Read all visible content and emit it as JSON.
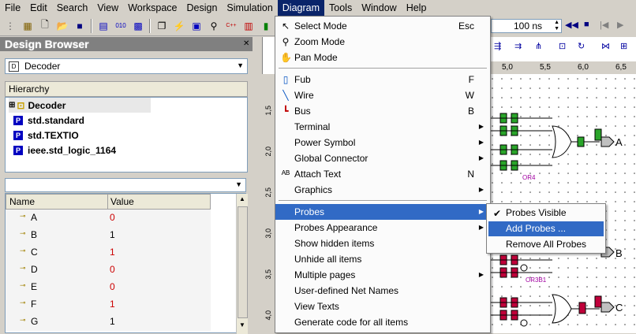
{
  "menubar": [
    "File",
    "Edit",
    "Search",
    "View",
    "Workspace",
    "Design",
    "Simulation",
    "Diagram",
    "Tools",
    "Window",
    "Help"
  ],
  "active_menu": "Diagram",
  "toolbar_right": {
    "time_value": "100 ns"
  },
  "browser": {
    "title": "Design Browser",
    "selected_design": "Decoder",
    "hierarchy_header": "Hierarchy",
    "tree": [
      "Decoder",
      "std.standard",
      "std.TEXTIO",
      "ieee.std_logic_1164"
    ],
    "signals_header": {
      "name": "Name",
      "value": "Value"
    },
    "signals": [
      {
        "name": "A",
        "value": "0"
      },
      {
        "name": "B",
        "value": "1"
      },
      {
        "name": "C",
        "value": "1"
      },
      {
        "name": "D",
        "value": "0"
      },
      {
        "name": "E",
        "value": "0"
      },
      {
        "name": "F",
        "value": "1"
      },
      {
        "name": "G",
        "value": "1"
      }
    ]
  },
  "canvas": {
    "ruler_top": [
      "5,0",
      "5,5",
      "6,0",
      "6,5"
    ],
    "ruler_left": [
      "1,5",
      "2,0",
      "2,5",
      "3,0",
      "3,5",
      "4,0"
    ],
    "labels": {
      "or4": "OR4",
      "or3b1": "OR3B1",
      "out_a": "A",
      "out_b": "B",
      "out_c": "C"
    }
  },
  "diagram_menu": [
    {
      "label": "Select Mode",
      "shortcut": "Esc",
      "icon": "arrow-cursor-icon"
    },
    {
      "label": "Zoom Mode",
      "shortcut": "",
      "icon": "magnifier-icon"
    },
    {
      "label": "Pan Mode",
      "shortcut": "",
      "icon": "hand-icon"
    },
    {
      "sep": true
    },
    {
      "label": "Fub",
      "shortcut": "F",
      "icon": "fub-icon"
    },
    {
      "label": "Wire",
      "shortcut": "W",
      "icon": "wire-icon"
    },
    {
      "label": "Bus",
      "shortcut": "B",
      "icon": "bus-icon"
    },
    {
      "label": "Terminal",
      "submenu": true
    },
    {
      "label": "Power Symbol",
      "submenu": true
    },
    {
      "label": "Global Connector",
      "submenu": true
    },
    {
      "label": "Attach Text",
      "shortcut": "N",
      "icon": "attach-text-icon"
    },
    {
      "label": "Graphics",
      "submenu": true
    },
    {
      "sep": true
    },
    {
      "label": "Probes",
      "submenu": true,
      "selected": true
    },
    {
      "label": "Probes Appearance",
      "submenu": true
    },
    {
      "label": "Show hidden items"
    },
    {
      "label": "Unhide all items"
    },
    {
      "label": "Multiple pages",
      "submenu": true
    },
    {
      "label": "User-defined Net Names"
    },
    {
      "label": "View Texts"
    },
    {
      "label": "Generate code for all items"
    }
  ],
  "probes_menu": [
    {
      "label": "Probes Visible",
      "checked": true
    },
    {
      "label": "Add Probes ...",
      "selected": true
    },
    {
      "label": "Remove All Probes"
    }
  ],
  "colors": {
    "menu_highlight": "#316ac5",
    "menubar_active": "#0a246a",
    "value_red": "#cc0000"
  }
}
